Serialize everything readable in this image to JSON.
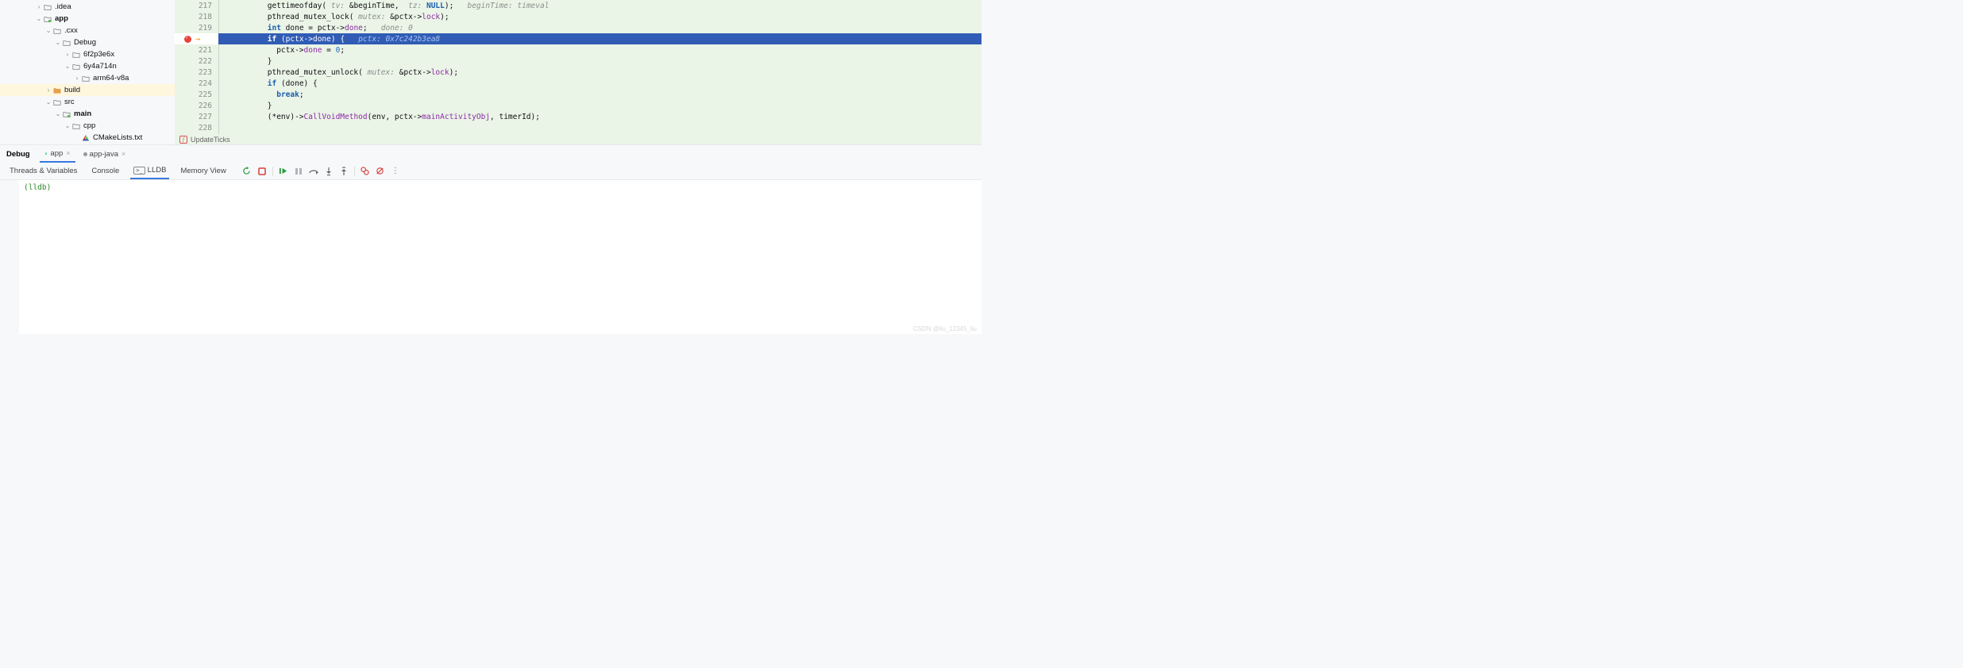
{
  "tree": {
    "idea": ".idea",
    "app": "app",
    "cxx": ".cxx",
    "debug": "Debug",
    "hash1": "6f2p3e6x",
    "hash2": "6y4a714n",
    "arch": "arm64-v8a",
    "build": "build",
    "src": "src",
    "main": "main",
    "cpp": "cpp",
    "cmake": "CMakeLists.txt"
  },
  "gutter": {
    "l217": "217",
    "l218": "218",
    "l219": "219",
    "l221": "221",
    "l222": "222",
    "l223": "223",
    "l224": "224",
    "l225": "225",
    "l226": "226",
    "l227": "227",
    "l228": "228"
  },
  "code": {
    "c217a": "gettimeofday( ",
    "c217h1": "tv: ",
    "c217b": "&beginTime,  ",
    "c217h2": "tz: ",
    "c217c": "NULL",
    "c217d": ");   ",
    "c217e": "beginTime: timeval",
    "c218a": "pthread_mutex_lock( ",
    "c218h": "mutex: ",
    "c218b": "&pctx->",
    "c218c": "lock",
    "c218d": ");",
    "c219a": "int",
    "c219b": " done = pctx->",
    "c219c": "done",
    "c219d": ";   ",
    "c219e": "done: 0",
    "c220a": "if",
    "c220b": " (pctx->",
    "c220c": "done",
    "c220d": ") {   ",
    "c220e": "pctx: 0x7c242b3ea8",
    "c221a": "  pctx->",
    "c221b": "done",
    "c221c": " = ",
    "c221d": "0",
    "c221e": ";",
    "c222a": "}",
    "c223a": "pthread_mutex_unlock( ",
    "c223h": "mutex: ",
    "c223b": "&pctx->",
    "c223c": "lock",
    "c223d": ");",
    "c224a": "if",
    "c224b": " (done) {",
    "c225a": "  ",
    "c225b": "break",
    "c225c": ";",
    "c226a": "}",
    "c227a": "(*env)->",
    "c227b": "CallVoidMethod",
    "c227c": "(env, pctx->",
    "c227d": "mainActivityObj",
    "c227e": ", timerId);"
  },
  "breadcrumb": {
    "fn": "UpdateTicks"
  },
  "debug": {
    "title": "Debug",
    "tab_app": "app",
    "tab_appjava": "app-java",
    "sub_threads": "Threads & Variables",
    "sub_console": "Console",
    "sub_lldb": "LLDB",
    "sub_memory": "Memory View"
  },
  "console": {
    "prompt": "(lldb)"
  },
  "watermark": "CSDN @liu_12345_liu"
}
